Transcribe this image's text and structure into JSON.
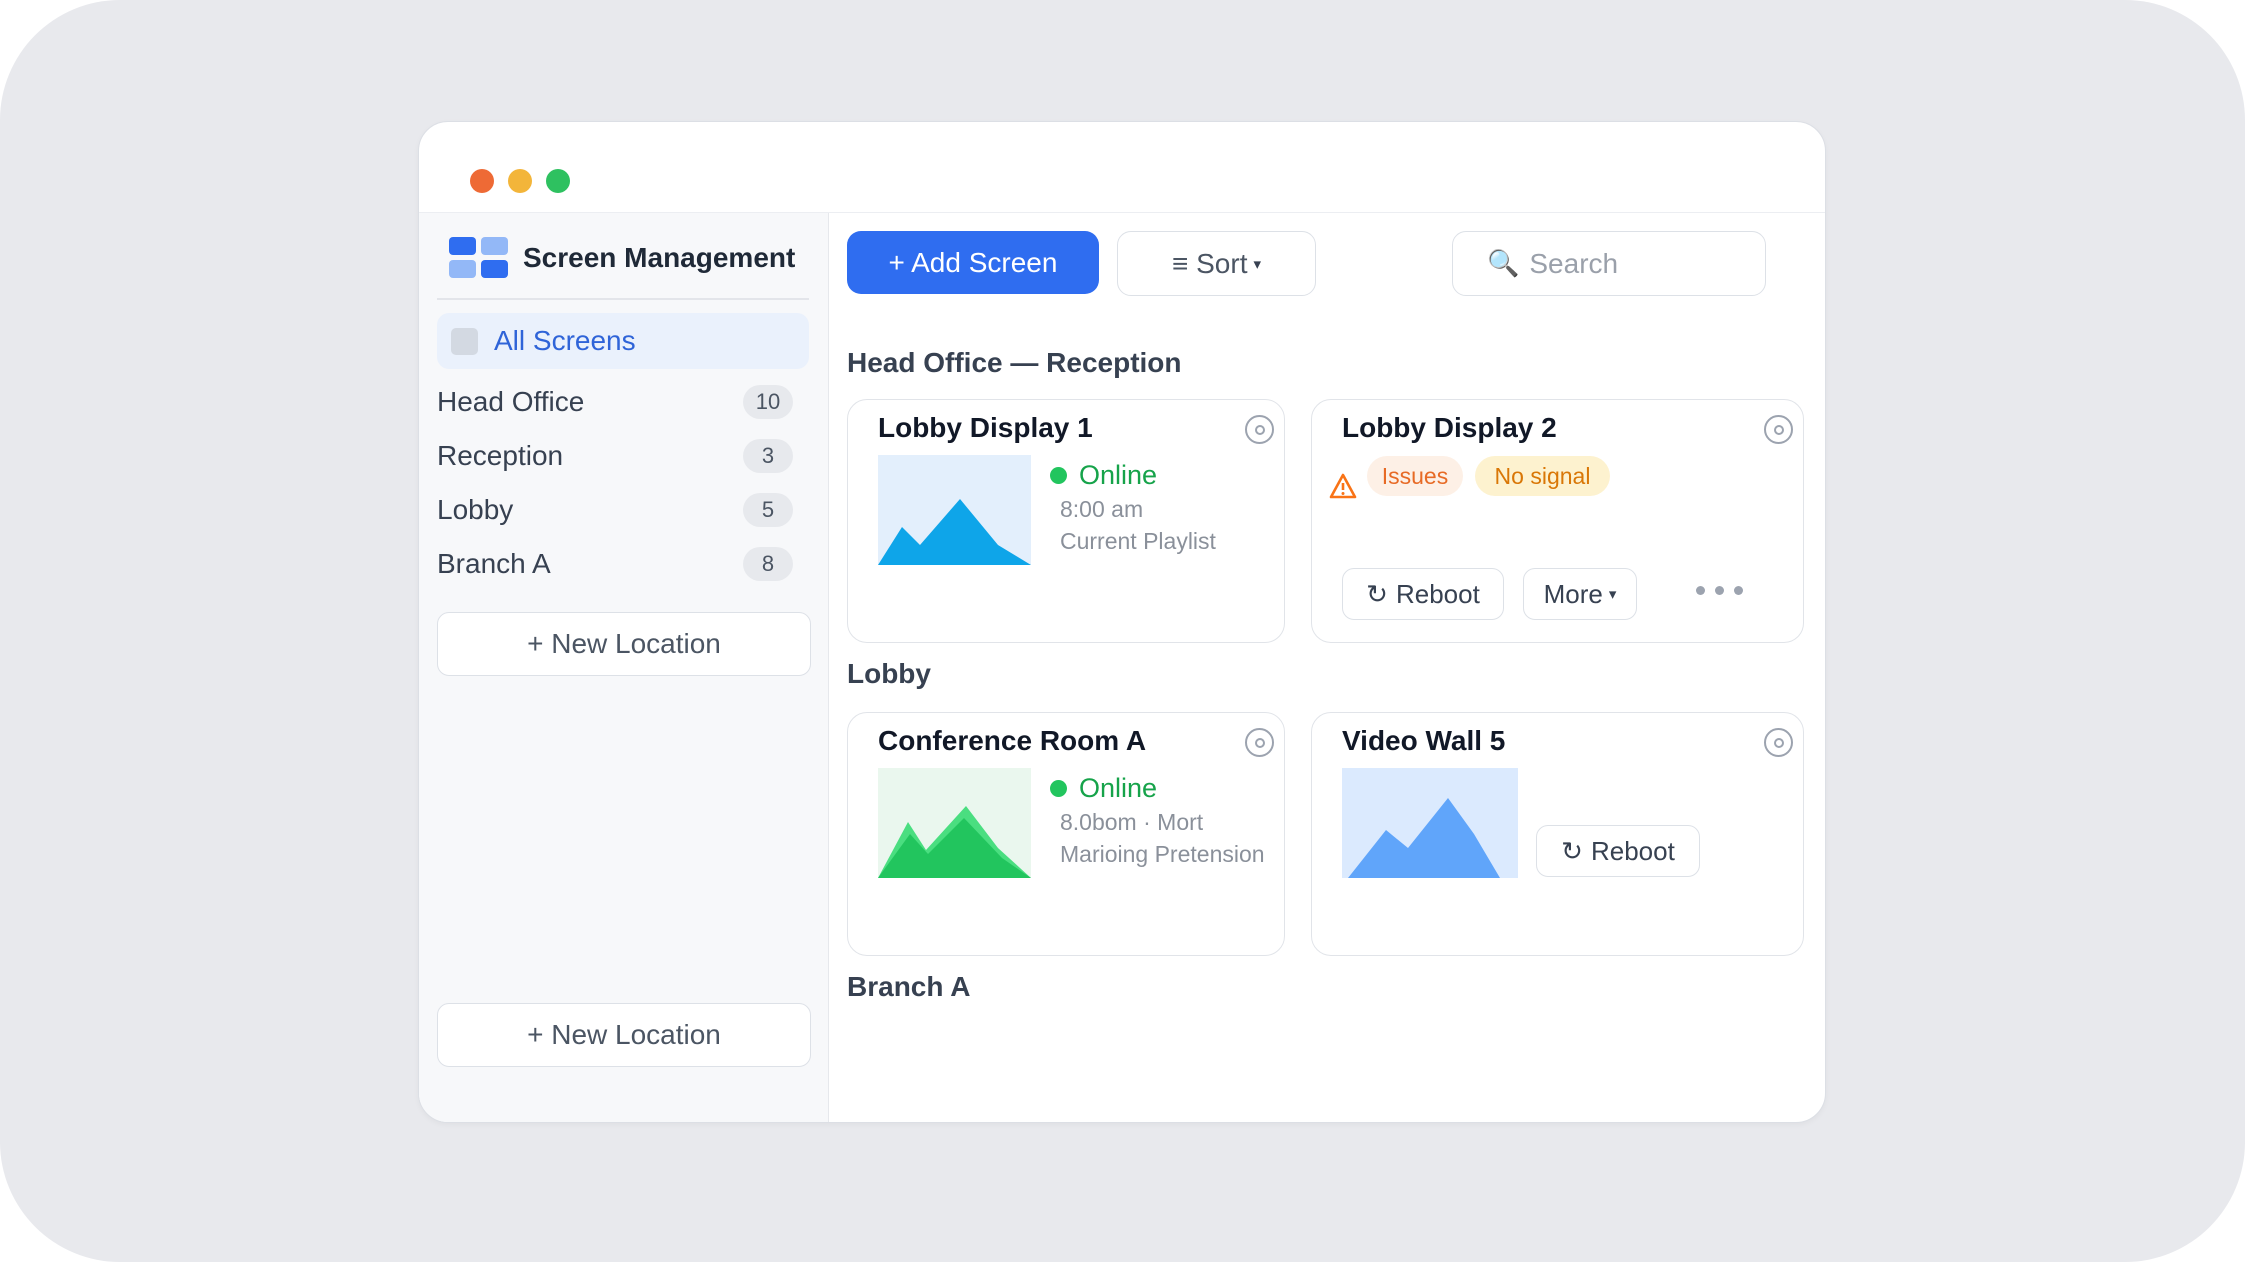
{
  "window": {
    "traffic_lights": [
      "close",
      "minimize",
      "maximize"
    ]
  },
  "sidebar": {
    "brand_title": "Screen Management",
    "active_item": "All Screens",
    "locations": [
      {
        "name": "Head Office",
        "count": "10"
      },
      {
        "name": "Reception",
        "count": "3"
      },
      {
        "name": "Lobby",
        "count": "5"
      },
      {
        "name": "Branch A",
        "count": "8"
      }
    ],
    "new_location_label": "+ New Location",
    "new_location_bottom_label": "+ New Location"
  },
  "toolbar": {
    "add_label": "+ Add Screen",
    "sort_label": "≡ Sort",
    "search_placeholder": "Search"
  },
  "sections": [
    {
      "title": "Head Office — Reception",
      "cards": [
        {
          "title": "Lobby Display 1",
          "status": "Online",
          "time": "8:00 am",
          "playlist": "Current Playlist"
        },
        {
          "title": "Lobby Display 2",
          "issues_label": "Issues",
          "no_signal_label": "No signal",
          "reboot_label": "Reboot",
          "more_label": "More"
        }
      ]
    },
    {
      "title": "Lobby",
      "cards": [
        {
          "title": "Conference Room A",
          "status": "Online",
          "time": "8.0bom · Mort",
          "playlist": "Marioing Pretension"
        },
        {
          "title": "Video Wall 5",
          "reboot_label": "Reboot"
        }
      ]
    },
    {
      "title": "Branch A",
      "cards": []
    }
  ],
  "colors": {
    "accent": "#2f6df0",
    "online": "#22c55e",
    "issues": "#e76a25",
    "no_signal": "#d97706"
  },
  "icons": [
    "logo-grid-icon",
    "search-icon",
    "settings-icon",
    "warning-icon",
    "reboot-icon",
    "more-dots-icon",
    "caret-down-icon"
  ]
}
